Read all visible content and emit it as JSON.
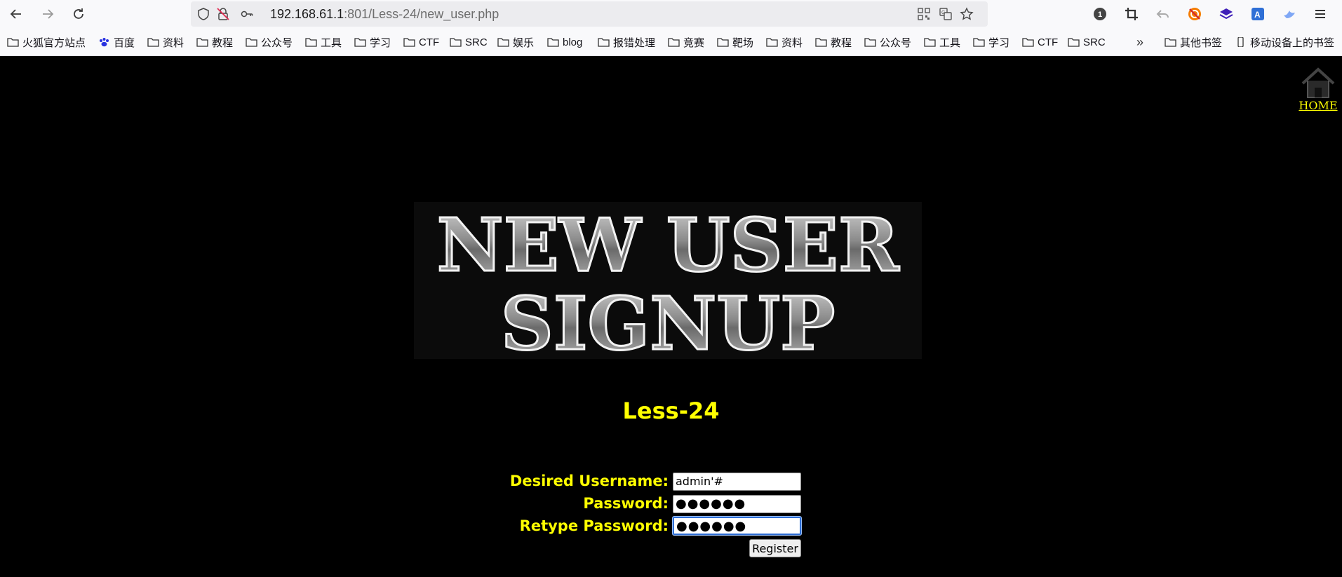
{
  "browser": {
    "url_host": "192.168.61.1",
    "url_rest": ":801/Less-24/new_user.php",
    "bookmarks": [
      "火狐官方站点",
      "百度",
      "资料",
      "教程",
      "公众号",
      "工具",
      "学习",
      "CTF",
      "SRC",
      "娱乐",
      "blog",
      "报错处理",
      "竞赛",
      "靶场",
      "资料",
      "教程",
      "公众号",
      "工具",
      "学习",
      "CTF",
      "SRC"
    ],
    "other_bookmarks": "其他书签",
    "mobile_bookmarks": "移动设备上的书签"
  },
  "page": {
    "home_label": "HOME",
    "banner_line1": "NEW USER",
    "banner_line2": "SIGNUP",
    "less_title": "Less-24",
    "form": {
      "username_label": "Desired Username:",
      "username_value": "admin'#",
      "password_label": "Password:",
      "password_value": "●●●●●●",
      "retype_label": "Retype Password:",
      "retype_value": "●●●●●●",
      "register_label": "Register"
    }
  },
  "colors": {
    "accent": "#ffff00",
    "background": "#000000"
  }
}
